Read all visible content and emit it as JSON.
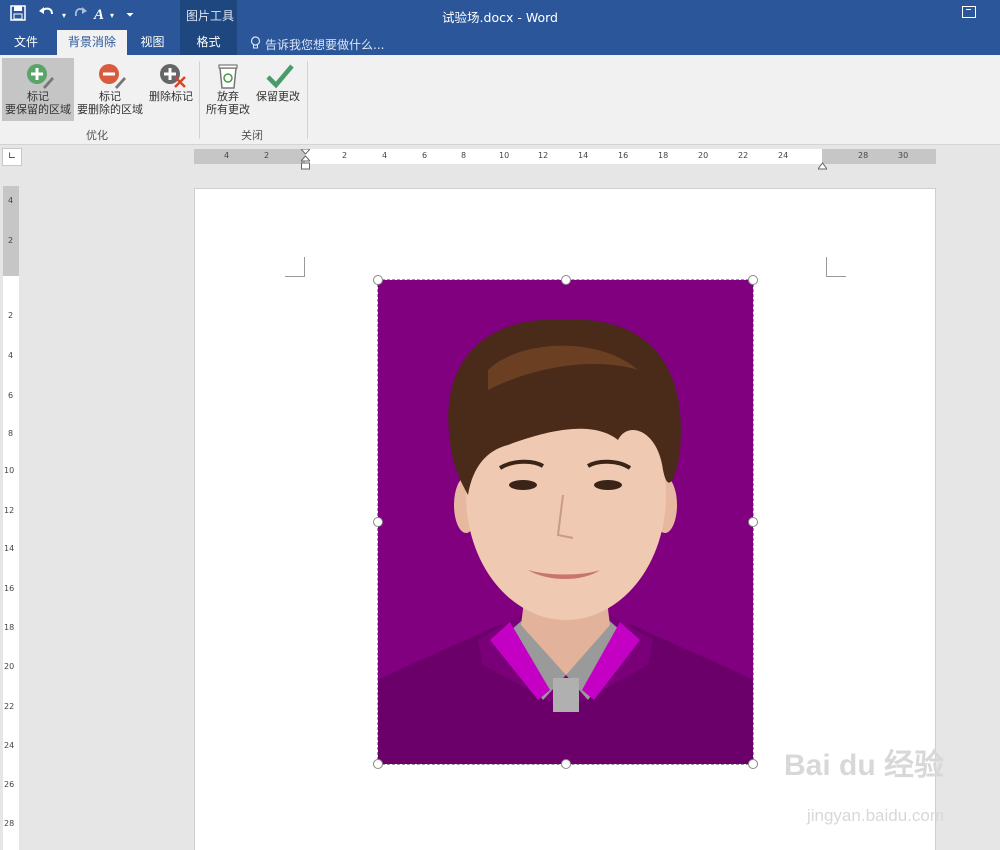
{
  "window": {
    "title": "试验场.docx - Word",
    "contextual_group": "图片工具"
  },
  "tabs": [
    {
      "label": "文件"
    },
    {
      "label": "背景消除",
      "active": true
    },
    {
      "label": "视图"
    },
    {
      "label": "格式"
    }
  ],
  "tell_me": "告诉我您想要做什么...",
  "ribbon": {
    "groups": [
      {
        "label": "优化",
        "buttons": [
          {
            "line1": "标记",
            "line2": "要保留的区域",
            "icon": "plus-pencil-icon",
            "selected": true
          },
          {
            "line1": "标记",
            "line2": "要删除的区域",
            "icon": "minus-pencil-icon"
          },
          {
            "line1": "删除标记",
            "line2": "",
            "icon": "delete-mark-icon"
          }
        ]
      },
      {
        "label": "关闭",
        "buttons": [
          {
            "line1": "放弃",
            "line2": "所有更改",
            "icon": "recycle-bin-icon"
          },
          {
            "line1": "保留更改",
            "line2": "",
            "icon": "checkmark-icon"
          }
        ]
      }
    ]
  },
  "ruler": {
    "horizontal_labels": [
      "4",
      "2",
      "2",
      "4",
      "6",
      "8",
      "10",
      "12",
      "14",
      "16",
      "18",
      "20",
      "22",
      "24",
      "28",
      "30"
    ],
    "vertical_labels": [
      "4",
      "2",
      "2",
      "4",
      "6",
      "8",
      "10",
      "12",
      "14",
      "16",
      "18",
      "20",
      "22",
      "24",
      "26",
      "28"
    ]
  },
  "watermark": {
    "brand": "Bai du 经验",
    "url": "jingyan.baidu.com"
  },
  "colors": {
    "title_bar": "#2b579a",
    "photo_background": "#800080"
  }
}
